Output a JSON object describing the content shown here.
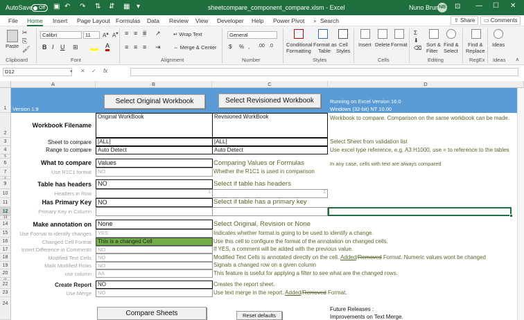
{
  "titlebar": {
    "autosave_label": "AutoSave",
    "autosave_state": "Off",
    "filename": "sheetcompare_component_compare.xlsm - Excel",
    "user": "Nuno Brum",
    "initials": "NB"
  },
  "menu": {
    "tabs": [
      "File",
      "Home",
      "Insert",
      "Page Layout",
      "Formulas",
      "Data",
      "Review",
      "View",
      "Developer",
      "Help",
      "Power Pivot"
    ],
    "search": "Search",
    "share": "Share",
    "comments": "Comments"
  },
  "ribbon": {
    "font_name": "Calibri",
    "font_size": "11",
    "number_format": "General",
    "paste": "Paste",
    "wrap_text": "Wrap Text",
    "merge_center": "Merge & Center",
    "conditional": "Conditional",
    "formatting": "Formatting",
    "format_as": "Format as",
    "table": "Table",
    "cell": "Cell",
    "styles_btn": "Styles",
    "insert": "Insert",
    "delete": "Delete",
    "format": "Format",
    "sort_filter": "Sort &",
    "filter": "Filter",
    "find_select": "Find &",
    "select": "Select",
    "find_replace": "Find &",
    "replace": "Replace",
    "ideas": "Ideas",
    "groups": [
      "Clipboard",
      "Font",
      "Alignment",
      "Number",
      "Styles",
      "Cells",
      "Editing",
      "RegEx",
      "Ideas"
    ]
  },
  "formula_bar": {
    "name_box": "D12",
    "fx": "fx",
    "content": ""
  },
  "grid": {
    "columns": [
      "A",
      "B",
      "C",
      "D"
    ],
    "rows": [
      "1",
      "2",
      "3",
      "4",
      "5",
      "6",
      "7",
      "8",
      "9",
      "10",
      "11",
      "12",
      "13",
      "14",
      "15",
      "16",
      "17",
      "18",
      "19",
      "20",
      "21",
      "22",
      "23",
      "24"
    ],
    "version": "Version 1.9",
    "btn_original": "Select Original Workbook",
    "btn_revised": "Select Revisioned Workbook",
    "env_line1": "Running on Excel Version 16.0",
    "env_line2": "Windows (32-bit) NT 10.00",
    "workbook_filename_label": "Workbook Filename",
    "original_workbook": "Original WorkBook",
    "revised_workbook": "Revisioned WorkBook",
    "workbook_desc": "Workbook to compare. Comparison on the same workbook can be made.",
    "sheet_label": "Sheet to compare",
    "sheet_orig": "[ALL]",
    "sheet_rev": "[ALL]",
    "sheet_desc": "Select Sheet from validation list",
    "range_label": "Range to compare",
    "range_orig": "Auto Detect",
    "range_rev": "Auto Detect",
    "range_desc": "Use excel type reference, e.g. A3:H1000, use = to reference to the tables",
    "what_label": "What to compare",
    "what_value": "Values",
    "what_desc": "Comparing Values or Formulas",
    "what_note": "In any case, cells with text are always compared",
    "r1c1_label": "Use R1C1 format",
    "r1c1_value": "NO",
    "r1c1_desc": "Whether the R1C1 is used in comparison",
    "headers_label": "Table has headers",
    "headers_value": "NO",
    "headers_desc": "Select if table has headers",
    "headers_row_label": "Headers in Row",
    "headers_row_b": "1",
    "headers_row_c": "1",
    "pk_label": "Has Primary Key",
    "pk_value": "NO",
    "pk_desc": "Select if table has a primary key",
    "pk_col_label": "Primary Key in Column",
    "annot_label": "Make annotation on",
    "annot_value": "None",
    "annot_desc": "Select Original, Revision or None",
    "usefmt_label": "Use Format to identify changes",
    "usefmt_value": "YES",
    "usefmt_desc": "Indicates whether format is going to be used to identify a change.",
    "changed_fmt_label": "Changed Cell Format",
    "changed_fmt_value": "This is a changed Cell",
    "changed_fmt_desc": "Use this cell to configure the format of the annotation on changed cells.",
    "insert_diff_label": "Insert Difference in Comments",
    "insert_diff_value": "NO",
    "insert_diff_desc": "If YES, a comment will be added with the previous value.",
    "modified_text_label": "Modified Text Cells",
    "modified_text_value": "NO",
    "modified_text_desc_a": "Modified Text Cells is annotated directly on the cell.",
    "added": "Added",
    "slash": "/",
    "removed": "Removed",
    "modified_text_desc_b": " Format. Numeric values wont be changed",
    "mark_rows_label": "Mark Modified Rows",
    "mark_rows_value": "NO",
    "mark_rows_desc": "Signals a changed row on a given column",
    "use_column_label": "use column",
    "use_column_value": "AA",
    "use_column_desc": "This feature is useful for applying a filter to see what are the changed rows.",
    "report_label": "Create Report",
    "report_value": "NO",
    "report_desc": "Creates the report sheet.",
    "merge_label": "Use Merge",
    "merge_value": "NO",
    "merge_desc_a": "Use text merge in the report.",
    "merge_desc_b": " Format.",
    "btn_compare": "Compare Sheets",
    "btn_reset": "Reset defaults",
    "future_1": "Future Releases :",
    "future_2": "Improvements on Text Merge."
  },
  "colors": {
    "header_blue": "#5b9bd5",
    "excel_green": "#1e6e3e",
    "changed_cell": "#70ad47",
    "desc_green": "#56682a"
  }
}
